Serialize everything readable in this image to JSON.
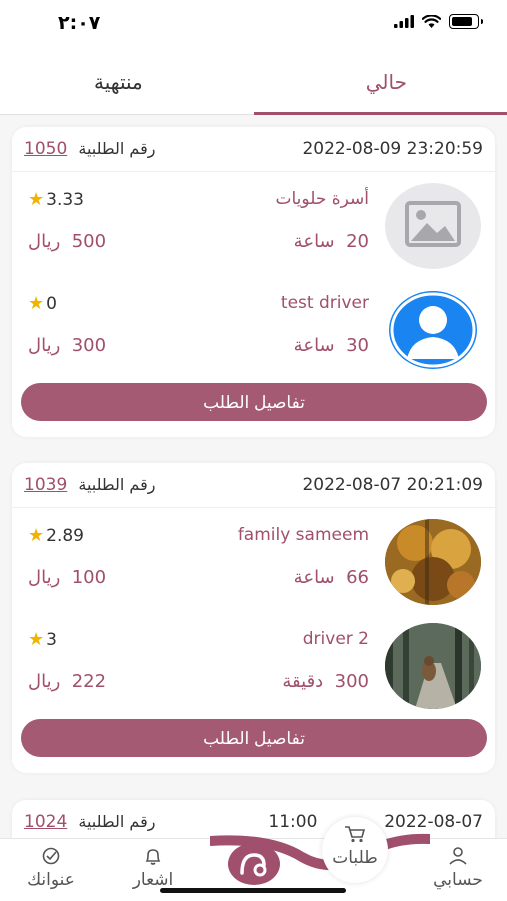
{
  "status_bar": {
    "time": "٢:٠٧"
  },
  "tabs": {
    "current": "حالي",
    "finished": "منتهية"
  },
  "order_label": "رقم الطلبية",
  "currency": "ريال",
  "details_button": "تفاصيل الطلب",
  "orders": [
    {
      "datetime": "2022-08-09 23:20:59",
      "number": "1050",
      "provider": {
        "name": "أسرة حلويات",
        "rating": "3.33",
        "duration_value": "20",
        "duration_unit": "ساعة",
        "price": "500"
      },
      "driver": {
        "name": "test driver",
        "rating": "0",
        "duration_value": "30",
        "duration_unit": "ساعة",
        "price": "300"
      }
    },
    {
      "datetime": "2022-08-07 20:21:09",
      "number": "1039",
      "provider": {
        "name": "family sameem",
        "rating": "2.89",
        "duration_value": "66",
        "duration_unit": "ساعة",
        "price": "100"
      },
      "driver": {
        "name": "driver 2",
        "rating": "3",
        "duration_value": "300",
        "duration_unit": "دقيقة",
        "price": "222"
      }
    },
    {
      "datetime_partial": "11:00",
      "date_partial": "2022-08-07",
      "number": "1024"
    }
  ],
  "bottom_nav": {
    "account": "حسابي",
    "orders": "طلبات",
    "notifications": "اشعار",
    "addresses": "عنوانك"
  },
  "colors": {
    "accent": "#a04f6c",
    "star": "#f0b400"
  }
}
